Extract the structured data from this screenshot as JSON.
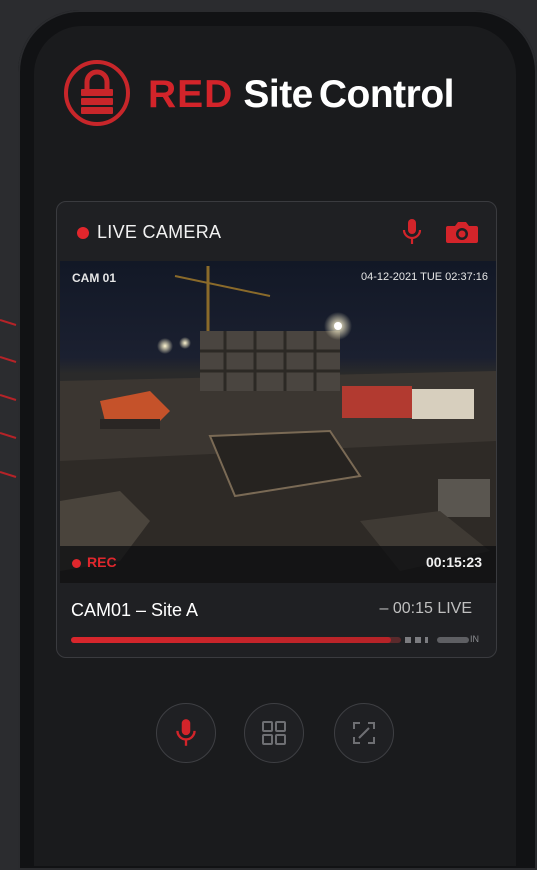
{
  "app": {
    "brand_red": "RED",
    "brand_site": "Site",
    "brand_control": "Control"
  },
  "card": {
    "live_label": "LIVE CAMERA",
    "overlay_cam": "CAM 01",
    "overlay_datetime": "04-12-2021 TUE 02:37:16",
    "rec_label": "REC",
    "rec_time": "00:15:23",
    "camera_name": "CAM01 – Site A",
    "time_live": "– 00:15  LIVE",
    "in_label": "IN",
    "progress_fraction": 0.97
  },
  "controls": [
    "mic-button",
    "grid-view-button",
    "fullscreen-button"
  ],
  "colors": {
    "accent": "#d3242a",
    "background": "#2b2c2f",
    "card": "#1f2023"
  }
}
